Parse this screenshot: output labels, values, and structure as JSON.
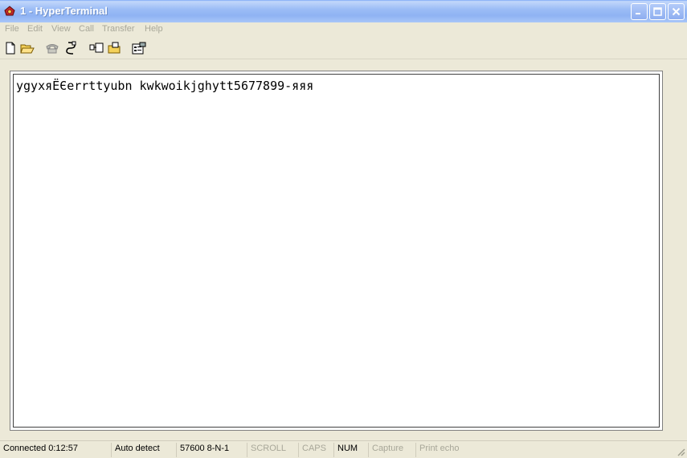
{
  "window": {
    "title": "1 - HyperTerminal",
    "icon": "hyperterminal-phone-icon"
  },
  "title_buttons": {
    "minimize": "minimize-icon",
    "maximize": "maximize-icon",
    "close": "close-icon"
  },
  "menu": {
    "items": [
      {
        "label": "File"
      },
      {
        "label": "Edit"
      },
      {
        "label": "View"
      },
      {
        "label": "Call"
      },
      {
        "label": "Transfer"
      },
      {
        "label": "Help"
      }
    ]
  },
  "toolbar": {
    "icons": [
      "new-icon",
      "open-icon",
      "call-icon",
      "disconnect-icon",
      "send-icon",
      "receive-icon",
      "properties-icon"
    ]
  },
  "terminal": {
    "text": "ygyxяЁЄerrttyubn kwkwoikjghytt5677899-яяя"
  },
  "status": {
    "connected": "Connected 0:12:57",
    "detect": "Auto detect",
    "settings": "57600 8-N-1",
    "scroll": "SCROLL",
    "caps": "CAPS",
    "num": "NUM",
    "capture": "Capture",
    "print_echo": "Print echo"
  },
  "colors": {
    "titlebar": "#9cbdf6",
    "background": "#ece9d8",
    "disabled_text": "#a8a799"
  }
}
